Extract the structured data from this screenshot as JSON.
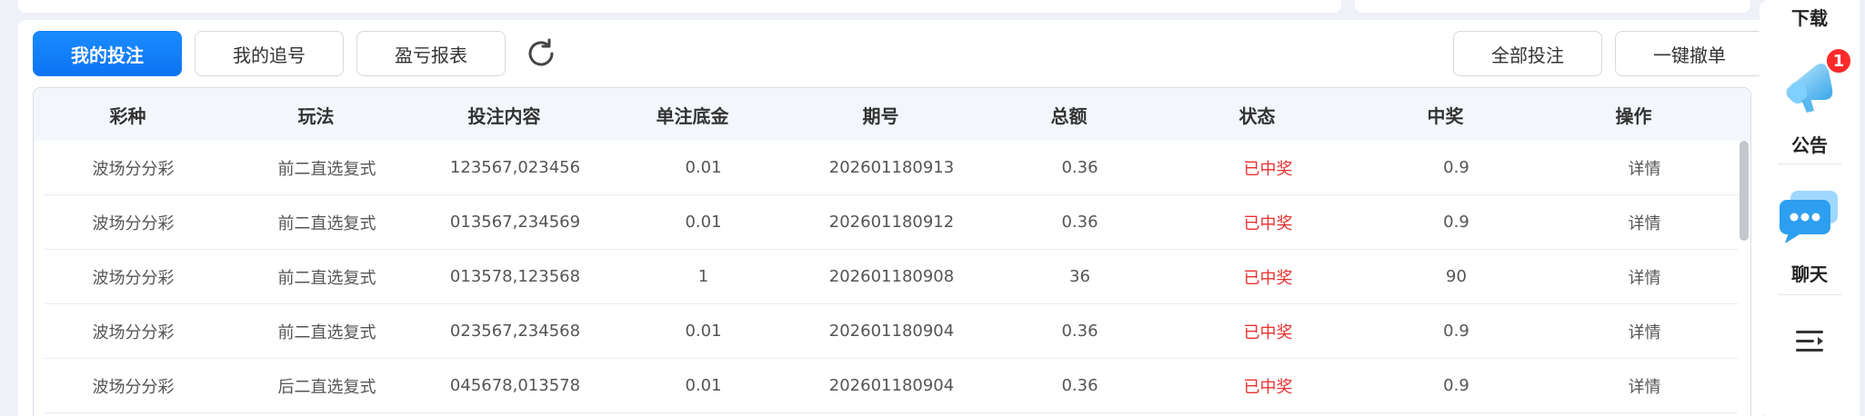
{
  "tabs": [
    {
      "label": "我的投注",
      "active": true
    },
    {
      "label": "我的追号",
      "active": false
    },
    {
      "label": "盈亏报表",
      "active": false
    }
  ],
  "actions": {
    "all_bets": "全部投注",
    "cancel_all": "一键撤单"
  },
  "table": {
    "headers": [
      "彩种",
      "玩法",
      "投注内容",
      "单注底金",
      "期号",
      "总额",
      "状态",
      "中奖",
      "操作"
    ],
    "rows": [
      [
        "波场分分彩",
        "前二直选复式",
        "123567,023456",
        "0.01",
        "202601180913",
        "0.36",
        "已中奖",
        "0.9",
        "详情"
      ],
      [
        "波场分分彩",
        "前二直选复式",
        "013567,234569",
        "0.01",
        "202601180912",
        "0.36",
        "已中奖",
        "0.9",
        "详情"
      ],
      [
        "波场分分彩",
        "前二直选复式",
        "013578,123568",
        "1",
        "202601180908",
        "36",
        "已中奖",
        "90",
        "详情"
      ],
      [
        "波场分分彩",
        "前二直选复式",
        "023567,234568",
        "0.01",
        "202601180904",
        "0.36",
        "已中奖",
        "0.9",
        "详情"
      ],
      [
        "波场分分彩",
        "后二直选复式",
        "045678,013578",
        "0.01",
        "202601180904",
        "0.36",
        "已中奖",
        "0.9",
        "详情"
      ]
    ]
  },
  "float_bar": {
    "download": "下载",
    "announcement": "公告",
    "announcement_badge": "1",
    "chat": "聊天",
    "menu_icon": "menu-collapse-icon"
  },
  "colors": {
    "primary": "#0d73f2",
    "status_won": "#e8302f",
    "header_bg": "#f3f7fc"
  }
}
